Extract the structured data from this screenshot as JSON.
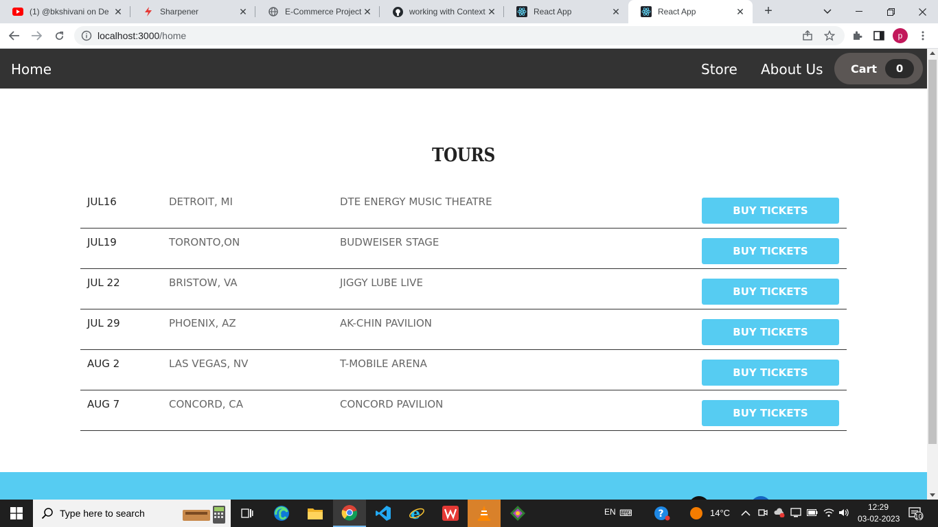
{
  "browser": {
    "tabs": [
      {
        "title": "(1) @bkshivani on De",
        "icon": "youtube-icon",
        "active": false
      },
      {
        "title": "Sharpener",
        "icon": "sharpener-icon",
        "active": false
      },
      {
        "title": "E-Commerce Project",
        "icon": "globe-icon",
        "active": false
      },
      {
        "title": "working with Context",
        "icon": "github-icon",
        "active": false
      },
      {
        "title": "React App",
        "icon": "react-icon",
        "active": false
      },
      {
        "title": "React App",
        "icon": "react-icon",
        "active": true
      }
    ],
    "url_host": "localhost:3000",
    "url_path": "/home",
    "profile_initial": "p"
  },
  "navbar": {
    "home": "Home",
    "store": "Store",
    "about": "About Us",
    "cart_label": "Cart",
    "cart_count": "0"
  },
  "page": {
    "title": "TOURS",
    "buy_label": "BUY TICKETS",
    "tours": [
      {
        "date": "JUL16",
        "city": "DETROIT, MI",
        "venue": "DTE ENERGY MUSIC THEATRE"
      },
      {
        "date": "JUL19",
        "city": "TORONTO,ON",
        "venue": "BUDWEISER STAGE"
      },
      {
        "date": "JUL 22",
        "city": "BRISTOW, VA",
        "venue": "JIGGY LUBE LIVE"
      },
      {
        "date": "JUL 29",
        "city": "PHOENIX, AZ",
        "venue": "AK-CHIN PAVILION"
      },
      {
        "date": "AUG 2",
        "city": "LAS VEGAS, NV",
        "venue": "T-MOBILE ARENA"
      },
      {
        "date": "AUG 7",
        "city": "CONCORD, CA",
        "venue": "CONCORD PAVILION"
      }
    ]
  },
  "taskbar": {
    "search_placeholder": "Type here to search",
    "language": "EN",
    "temperature": "14°C",
    "time": "12:29",
    "date": "03-02-2023",
    "notification_count": "10"
  },
  "colors": {
    "navbar_bg": "#333333",
    "button_blue": "#56ccf2",
    "cart_bg": "#5b5654"
  }
}
